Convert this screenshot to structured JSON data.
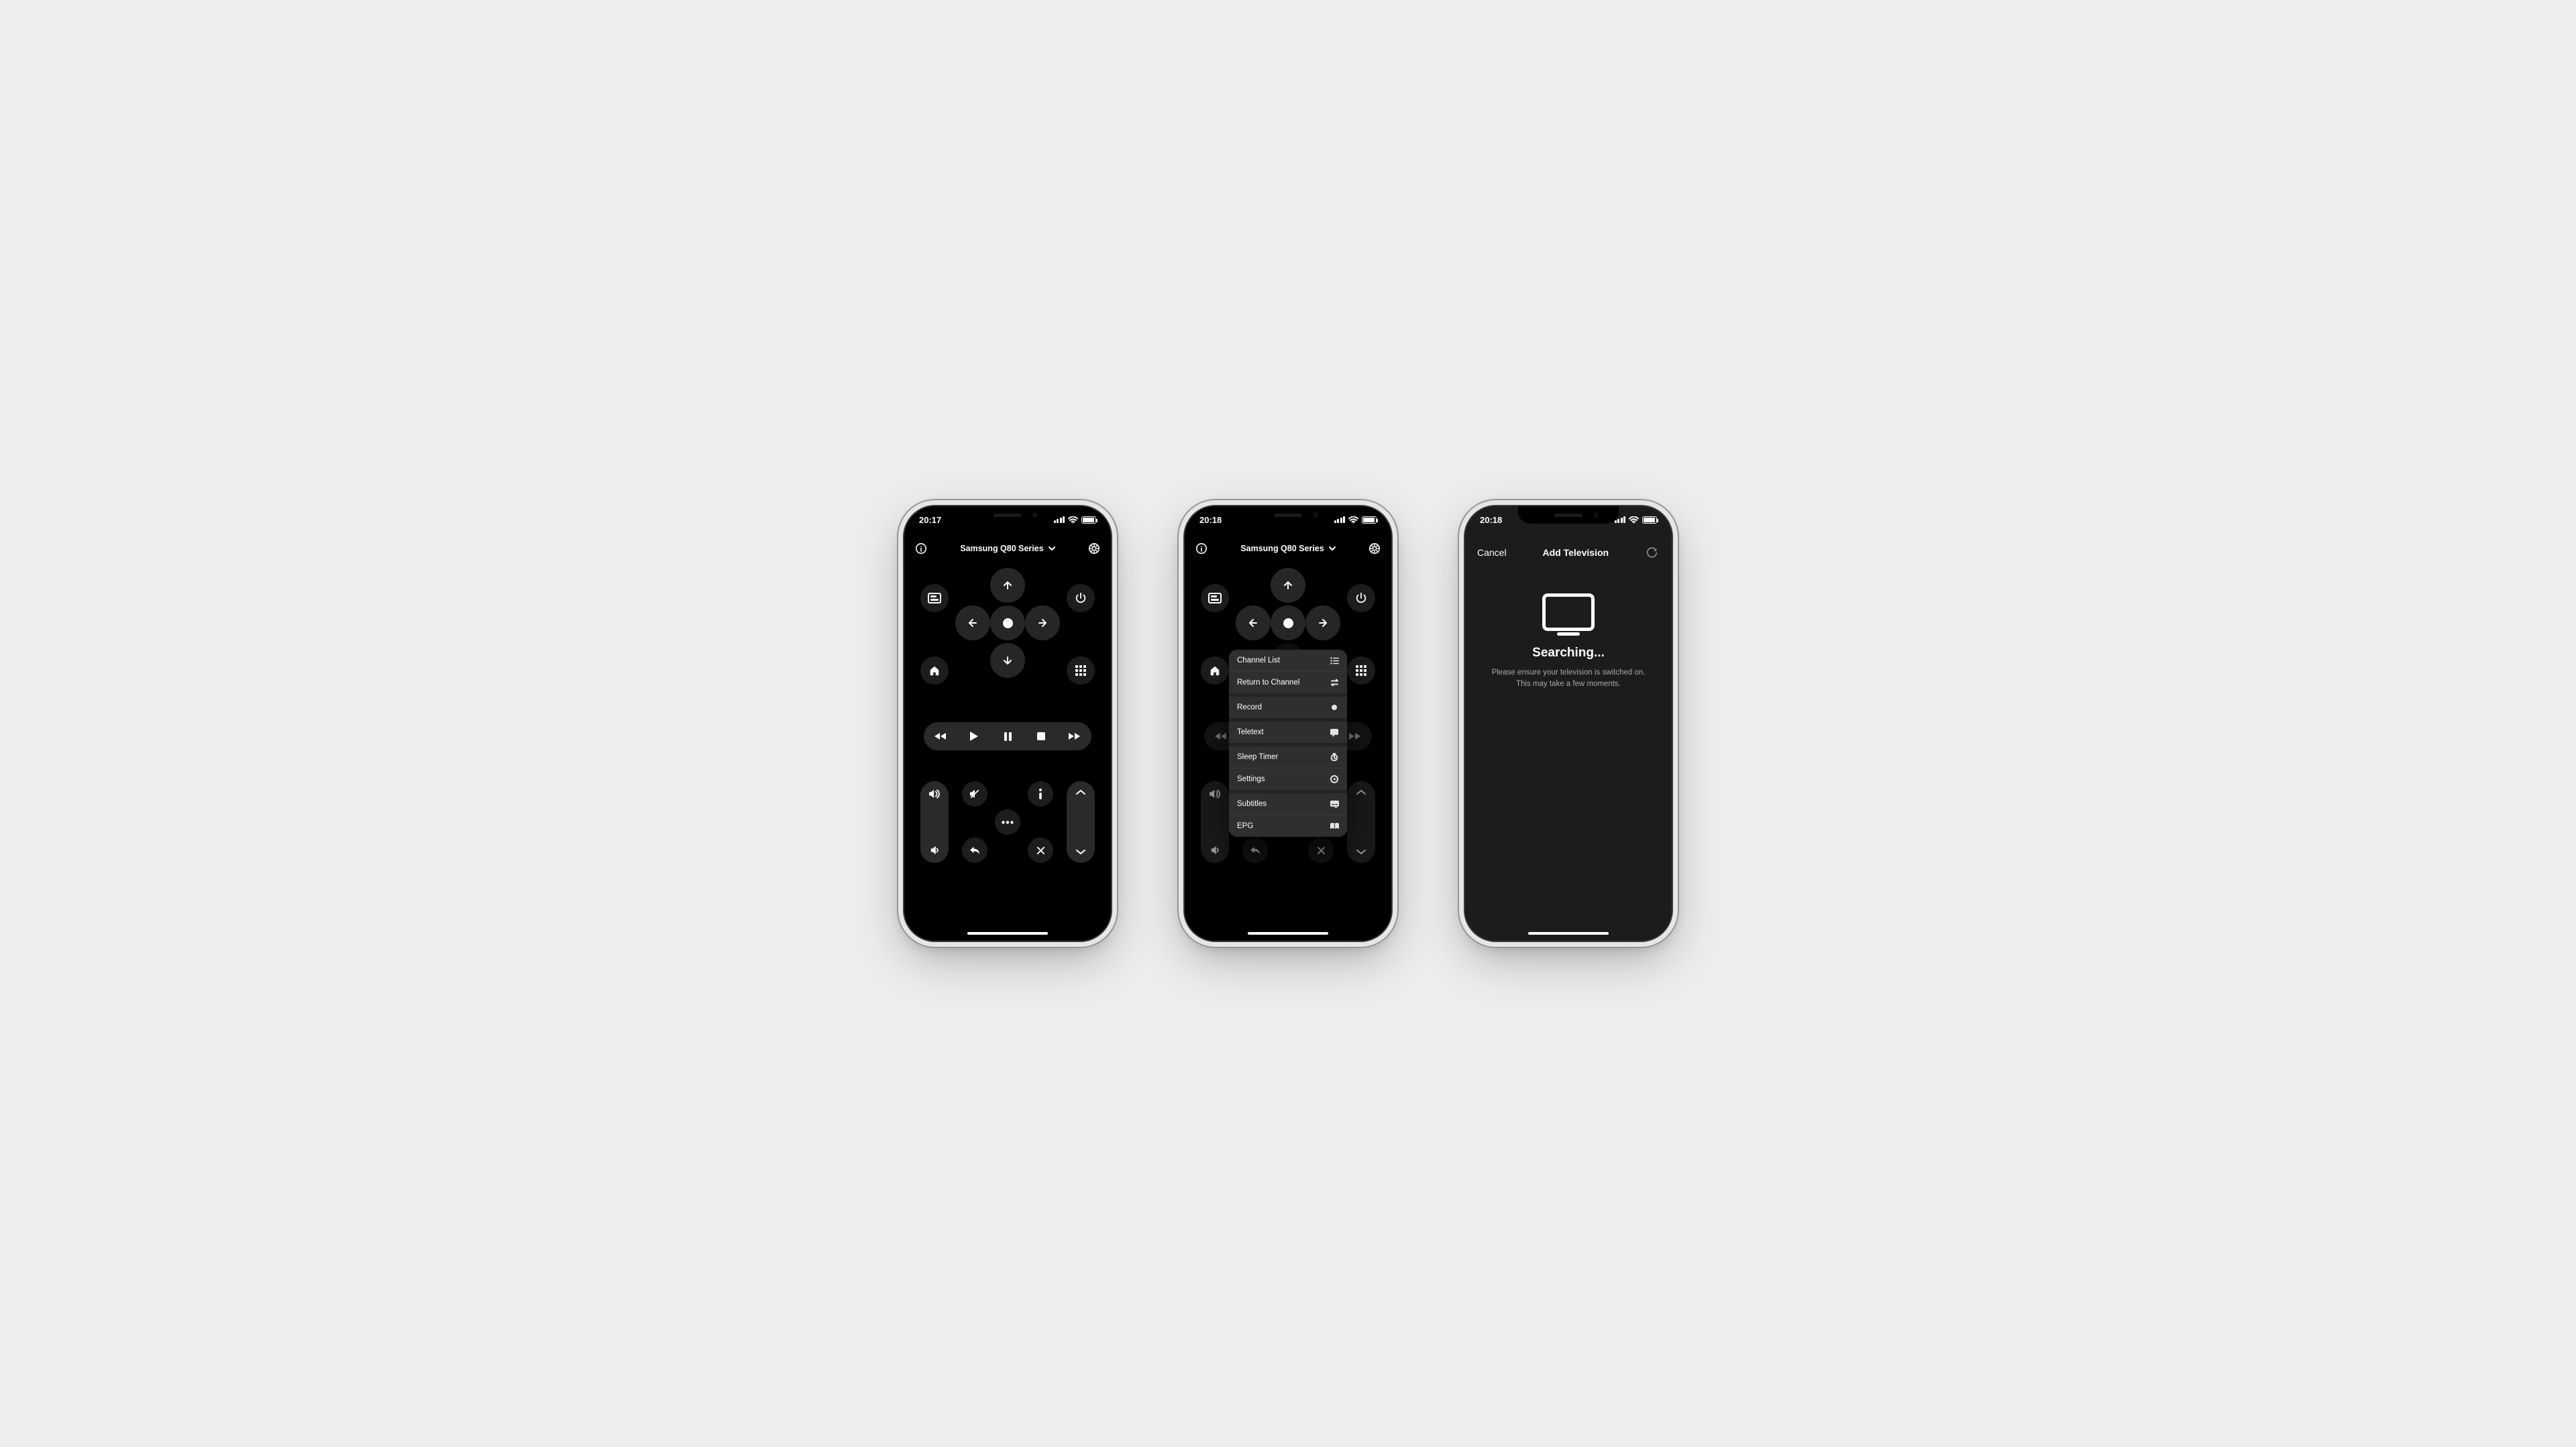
{
  "phones": {
    "p1": {
      "time": "20:17",
      "device": "Samsung Q80 Series"
    },
    "p2": {
      "time": "20:18",
      "device": "Samsung Q80 Series",
      "menu": [
        {
          "label": "Channel List",
          "icon": "list-icon"
        },
        {
          "label": "Return to Channel",
          "icon": "swap-icon"
        },
        {
          "label": "Record",
          "icon": "record-dot-icon"
        },
        {
          "label": "Teletext",
          "icon": "teletext-icon"
        },
        {
          "label": "Sleep Timer",
          "icon": "timer-icon"
        },
        {
          "label": "Settings",
          "icon": "settings-small-icon"
        },
        {
          "label": "Subtitles",
          "icon": "subtitles-icon"
        },
        {
          "label": "EPG",
          "icon": "guide-icon"
        }
      ]
    },
    "p3": {
      "time": "20:18",
      "cancel": "Cancel",
      "title": "Add Television",
      "heading": "Searching...",
      "sub1": "Please ensure your television is switched on.",
      "sub2": "This may take a few moments."
    }
  }
}
